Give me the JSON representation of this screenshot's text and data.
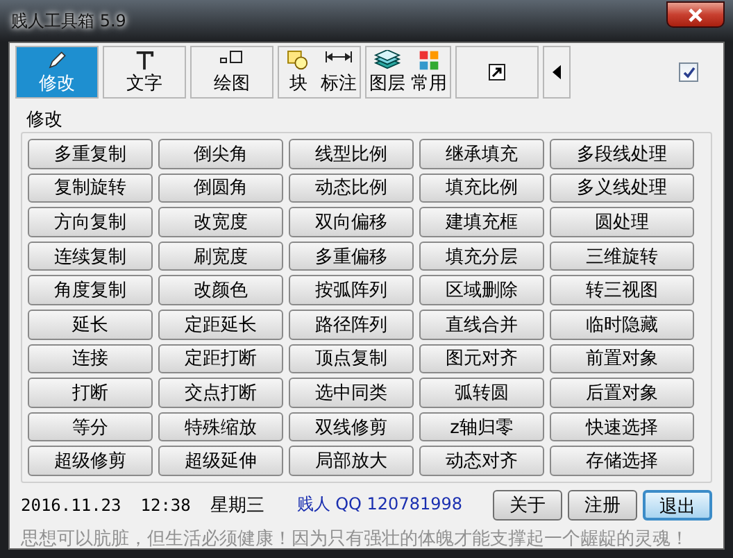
{
  "window": {
    "title": "贱人工具箱 5.9"
  },
  "toolbar": {
    "tabs": [
      {
        "label": "修改",
        "kind": "modify",
        "selected": true
      },
      {
        "label": "文字",
        "kind": "text",
        "selected": false
      },
      {
        "label": "绘图",
        "kind": "draw",
        "selected": false
      },
      {
        "label": "块",
        "kind": "block",
        "selected": false
      },
      {
        "label": "标注",
        "kind": "dimension",
        "selected": false
      },
      {
        "label": "图层",
        "kind": "layer",
        "selected": false
      },
      {
        "label": "常用",
        "kind": "common",
        "selected": false
      }
    ],
    "pin_checked": true
  },
  "group": {
    "title": "修改",
    "buttons": [
      [
        "多重复制",
        "倒尖角",
        "线型比例",
        "继承填充",
        "多段线处理"
      ],
      [
        "复制旋转",
        "倒圆角",
        "动态比例",
        "填充比例",
        "多义线处理"
      ],
      [
        "方向复制",
        "改宽度",
        "双向偏移",
        "建填充框",
        "圆处理"
      ],
      [
        "连续复制",
        "刷宽度",
        "多重偏移",
        "填充分层",
        "三维旋转"
      ],
      [
        "角度复制",
        "改颜色",
        "按弧阵列",
        "区域删除",
        "转三视图"
      ],
      [
        "延长",
        "定距延长",
        "路径阵列",
        "直线合并",
        "临时隐藏"
      ],
      [
        "连接",
        "定距打断",
        "顶点复制",
        "图元对齐",
        "前置对象"
      ],
      [
        "打断",
        "交点打断",
        "选中同类",
        "弧转圆",
        "后置对象"
      ],
      [
        "等分",
        "特殊缩放",
        "双线修剪",
        "z轴归零",
        "快速选择"
      ],
      [
        "超级修剪",
        "超级延伸",
        "局部放大",
        "动态对齐",
        "存储选择"
      ]
    ]
  },
  "status": {
    "date": "2016.11.23",
    "time": "12:38",
    "weekday": "星期三",
    "contact": "贱人 QQ 120781998",
    "buttons": [
      {
        "label": "关于",
        "default": false
      },
      {
        "label": "注册",
        "default": false
      },
      {
        "label": "退出",
        "default": true
      }
    ],
    "motto": "思想可以肮脏，但生活必须健康！因为只有强壮的体魄才能支撑起一个龌龊的灵魂！"
  }
}
